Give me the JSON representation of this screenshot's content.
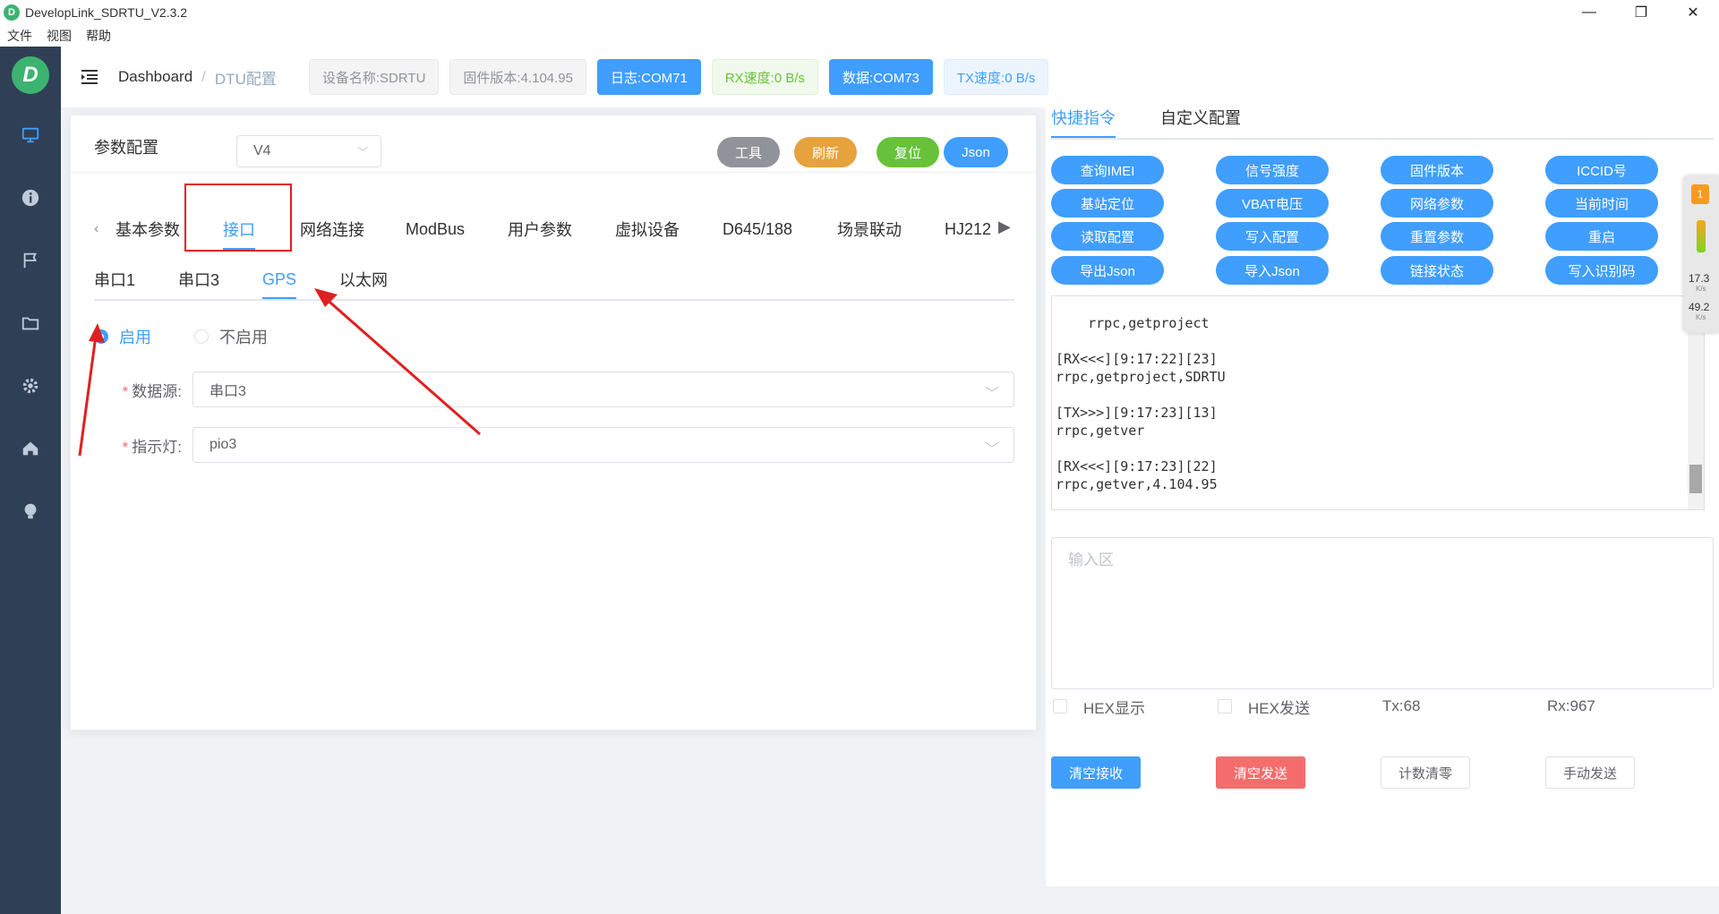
{
  "window": {
    "title": "DevelopLink_SDRTU_V2.3.2",
    "minimize": "—",
    "restore": "❐",
    "close": "✕"
  },
  "menu": [
    "文件",
    "视图",
    "帮助"
  ],
  "sidebar": {
    "logo": "D"
  },
  "header": {
    "breadcrumb_home": "Dashboard",
    "breadcrumb_sep": "/",
    "breadcrumb_current": "DTU配置",
    "device_name": "设备名称:SDRTU",
    "firmware": "固件版本:4.104.95",
    "log_port": "日志:COM71",
    "rx_speed": "RX速度:0 B/s",
    "data_port": "数据:COM73",
    "tx_speed": "TX速度:0 B/s"
  },
  "config": {
    "title": "参数配置",
    "version_value": "V4",
    "buttons": {
      "tools": "工具",
      "refresh": "刷新",
      "reset": "复位",
      "json": "Json"
    },
    "colors": {
      "tools": "#909399",
      "refresh": "#e6a23c",
      "reset": "#67c23a",
      "json": "#409eff"
    },
    "main_tabs": [
      "基本参数",
      "接口",
      "网络连接",
      "ModBus",
      "用户参数",
      "虚拟设备",
      "D645/188",
      "场景联动",
      "HJ212"
    ],
    "active_main_tab": "接口",
    "sub_tabs": [
      "串口1",
      "串口3",
      "GPS",
      "以太网"
    ],
    "active_sub_tab": "GPS",
    "radio_enable": "启用",
    "radio_disable": "不启用",
    "data_source_label": "数据源:",
    "data_source_value": "串口3",
    "indicator_label": "指示灯:",
    "indicator_value": "pio3"
  },
  "right": {
    "tabs": [
      "快捷指令",
      "自定义配置"
    ],
    "commands": [
      "查询IMEI",
      "信号强度",
      "固件版本",
      "ICCID号",
      "基站定位",
      "VBAT电压",
      "网络参数",
      "当前时间",
      "读取配置",
      "写入配置",
      "重置参数",
      "重启",
      "导出Json",
      "导入Json",
      "链接状态",
      "写入识别码"
    ],
    "console_text": "rrpc,getproject\n\n[RX<<<][9:17:22][23]\nrrpc,getproject,SDRTU\n\n[TX>>>][9:17:23][13]\nrrpc,getver\n\n[RX<<<][9:17:23][22]\nrrpc,getver,4.104.95",
    "input_placeholder": "输入区",
    "hex_display": "HEX显示",
    "hex_send": "HEX发送",
    "tx_count": "Tx:68",
    "rx_count": "Rx:967",
    "clear_rx": "清空接收",
    "clear_tx": "清空发送",
    "reset_count": "计数清零",
    "manual_send": "手动发送"
  },
  "widget": {
    "badge": "1",
    "up_speed": "17.3",
    "up_unit": "K/s",
    "down_speed": "49.2",
    "down_unit": "K/s"
  }
}
